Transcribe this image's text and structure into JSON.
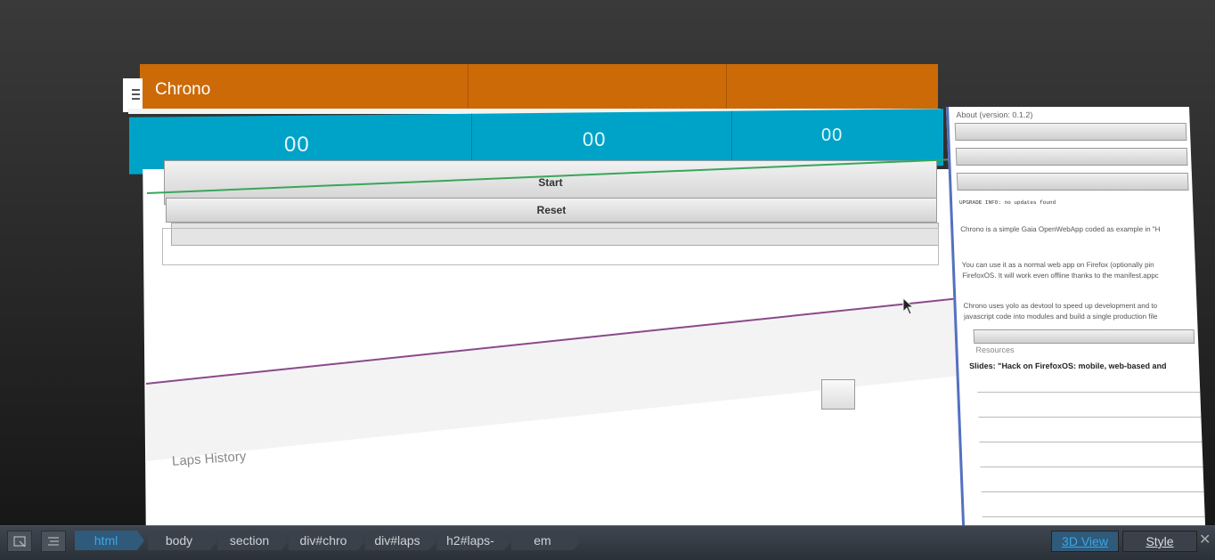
{
  "app": {
    "title": "Chrono",
    "timer": {
      "minutes": "00",
      "seconds": "00",
      "centiseconds": "00"
    },
    "start_label": "Start",
    "reset_label": "Reset",
    "laps_title": "Laps History"
  },
  "side": {
    "about": "About (version: 0.1.2)",
    "update_info": "UPGRADE INFO: no updates found",
    "para1": "Chrono is a simple Gaia OpenWebApp coded as example in \"H",
    "para2a": "You can use it as a normal web app on Firefox (optionally pin",
    "para2b": "FirefoxOS. It will work even offline thanks to the manifest.appc",
    "para3a": "Chrono uses yolo as devtool to speed up development and to",
    "para3b": "javascript code into modules and build a single production file",
    "resources": "Resources",
    "slides": "Slides: \"Hack on FirefoxOS: mobile, web-based and"
  },
  "toolbar": {
    "crumbs": [
      "html",
      "body",
      "section",
      "div#chro",
      "div#laps",
      "h2#laps-",
      "em"
    ],
    "view_3d": "3D View",
    "style": "Style",
    "close": "✕"
  }
}
